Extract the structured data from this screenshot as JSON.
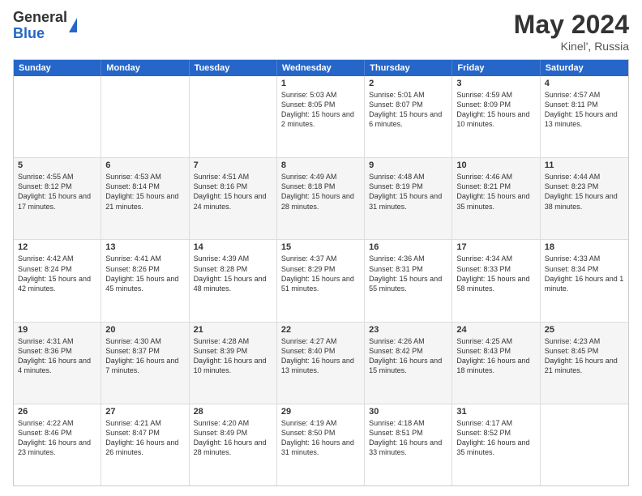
{
  "logo": {
    "line1": "General",
    "line2": "Blue"
  },
  "title": {
    "month_year": "May 2024",
    "location": "Kinel', Russia"
  },
  "days_of_week": [
    "Sunday",
    "Monday",
    "Tuesday",
    "Wednesday",
    "Thursday",
    "Friday",
    "Saturday"
  ],
  "rows": [
    {
      "alt": false,
      "cells": [
        {
          "day": "",
          "detail": ""
        },
        {
          "day": "",
          "detail": ""
        },
        {
          "day": "",
          "detail": ""
        },
        {
          "day": "1",
          "detail": "Sunrise: 5:03 AM\nSunset: 8:05 PM\nDaylight: 15 hours\nand 2 minutes."
        },
        {
          "day": "2",
          "detail": "Sunrise: 5:01 AM\nSunset: 8:07 PM\nDaylight: 15 hours\nand 6 minutes."
        },
        {
          "day": "3",
          "detail": "Sunrise: 4:59 AM\nSunset: 8:09 PM\nDaylight: 15 hours\nand 10 minutes."
        },
        {
          "day": "4",
          "detail": "Sunrise: 4:57 AM\nSunset: 8:11 PM\nDaylight: 15 hours\nand 13 minutes."
        }
      ]
    },
    {
      "alt": true,
      "cells": [
        {
          "day": "5",
          "detail": "Sunrise: 4:55 AM\nSunset: 8:12 PM\nDaylight: 15 hours\nand 17 minutes."
        },
        {
          "day": "6",
          "detail": "Sunrise: 4:53 AM\nSunset: 8:14 PM\nDaylight: 15 hours\nand 21 minutes."
        },
        {
          "day": "7",
          "detail": "Sunrise: 4:51 AM\nSunset: 8:16 PM\nDaylight: 15 hours\nand 24 minutes."
        },
        {
          "day": "8",
          "detail": "Sunrise: 4:49 AM\nSunset: 8:18 PM\nDaylight: 15 hours\nand 28 minutes."
        },
        {
          "day": "9",
          "detail": "Sunrise: 4:48 AM\nSunset: 8:19 PM\nDaylight: 15 hours\nand 31 minutes."
        },
        {
          "day": "10",
          "detail": "Sunrise: 4:46 AM\nSunset: 8:21 PM\nDaylight: 15 hours\nand 35 minutes."
        },
        {
          "day": "11",
          "detail": "Sunrise: 4:44 AM\nSunset: 8:23 PM\nDaylight: 15 hours\nand 38 minutes."
        }
      ]
    },
    {
      "alt": false,
      "cells": [
        {
          "day": "12",
          "detail": "Sunrise: 4:42 AM\nSunset: 8:24 PM\nDaylight: 15 hours\nand 42 minutes."
        },
        {
          "day": "13",
          "detail": "Sunrise: 4:41 AM\nSunset: 8:26 PM\nDaylight: 15 hours\nand 45 minutes."
        },
        {
          "day": "14",
          "detail": "Sunrise: 4:39 AM\nSunset: 8:28 PM\nDaylight: 15 hours\nand 48 minutes."
        },
        {
          "day": "15",
          "detail": "Sunrise: 4:37 AM\nSunset: 8:29 PM\nDaylight: 15 hours\nand 51 minutes."
        },
        {
          "day": "16",
          "detail": "Sunrise: 4:36 AM\nSunset: 8:31 PM\nDaylight: 15 hours\nand 55 minutes."
        },
        {
          "day": "17",
          "detail": "Sunrise: 4:34 AM\nSunset: 8:33 PM\nDaylight: 15 hours\nand 58 minutes."
        },
        {
          "day": "18",
          "detail": "Sunrise: 4:33 AM\nSunset: 8:34 PM\nDaylight: 16 hours\nand 1 minute."
        }
      ]
    },
    {
      "alt": true,
      "cells": [
        {
          "day": "19",
          "detail": "Sunrise: 4:31 AM\nSunset: 8:36 PM\nDaylight: 16 hours\nand 4 minutes."
        },
        {
          "day": "20",
          "detail": "Sunrise: 4:30 AM\nSunset: 8:37 PM\nDaylight: 16 hours\nand 7 minutes."
        },
        {
          "day": "21",
          "detail": "Sunrise: 4:28 AM\nSunset: 8:39 PM\nDaylight: 16 hours\nand 10 minutes."
        },
        {
          "day": "22",
          "detail": "Sunrise: 4:27 AM\nSunset: 8:40 PM\nDaylight: 16 hours\nand 13 minutes."
        },
        {
          "day": "23",
          "detail": "Sunrise: 4:26 AM\nSunset: 8:42 PM\nDaylight: 16 hours\nand 15 minutes."
        },
        {
          "day": "24",
          "detail": "Sunrise: 4:25 AM\nSunset: 8:43 PM\nDaylight: 16 hours\nand 18 minutes."
        },
        {
          "day": "25",
          "detail": "Sunrise: 4:23 AM\nSunset: 8:45 PM\nDaylight: 16 hours\nand 21 minutes."
        }
      ]
    },
    {
      "alt": false,
      "cells": [
        {
          "day": "26",
          "detail": "Sunrise: 4:22 AM\nSunset: 8:46 PM\nDaylight: 16 hours\nand 23 minutes."
        },
        {
          "day": "27",
          "detail": "Sunrise: 4:21 AM\nSunset: 8:47 PM\nDaylight: 16 hours\nand 26 minutes."
        },
        {
          "day": "28",
          "detail": "Sunrise: 4:20 AM\nSunset: 8:49 PM\nDaylight: 16 hours\nand 28 minutes."
        },
        {
          "day": "29",
          "detail": "Sunrise: 4:19 AM\nSunset: 8:50 PM\nDaylight: 16 hours\nand 31 minutes."
        },
        {
          "day": "30",
          "detail": "Sunrise: 4:18 AM\nSunset: 8:51 PM\nDaylight: 16 hours\nand 33 minutes."
        },
        {
          "day": "31",
          "detail": "Sunrise: 4:17 AM\nSunset: 8:52 PM\nDaylight: 16 hours\nand 35 minutes."
        },
        {
          "day": "",
          "detail": ""
        }
      ]
    }
  ]
}
